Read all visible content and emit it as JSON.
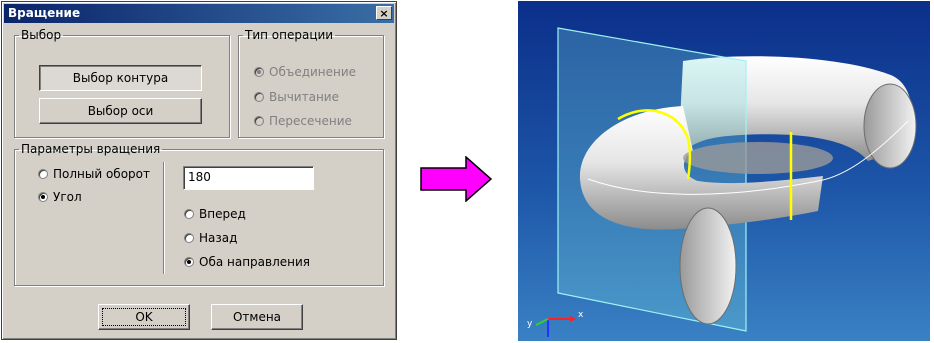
{
  "dialog": {
    "title": "Вращение",
    "close_glyph": "×",
    "selection_group": {
      "label": "Выбор",
      "contour_button": "Выбор контура",
      "axis_button": "Выбор оси"
    },
    "operation_group": {
      "label": "Тип операции",
      "options": [
        "Объединение",
        "Вычитание",
        "Пересечение"
      ],
      "selected": 0,
      "enabled": false
    },
    "rotation_group": {
      "label": "Параметры вращения",
      "mode_options": [
        "Полный оборот",
        "Угол"
      ],
      "mode_selected": 1,
      "angle_value": "180",
      "direction_options": [
        "Вперед",
        "Назад",
        "Оба направления"
      ],
      "direction_selected": 2
    },
    "ok_button": "OK",
    "cancel_button": "Отмена"
  },
  "arrow": {
    "icon": "right-arrow-icon",
    "fill": "#ff00ff"
  },
  "viewport": {
    "background_top": "#0b2f8a",
    "background_bottom": "#3a81c4",
    "plane_color": "#7fe0e0",
    "profile_color": "#ffff00",
    "axis_color": "#ffff00",
    "triad_labels": {
      "x": "x",
      "y": "y"
    }
  }
}
